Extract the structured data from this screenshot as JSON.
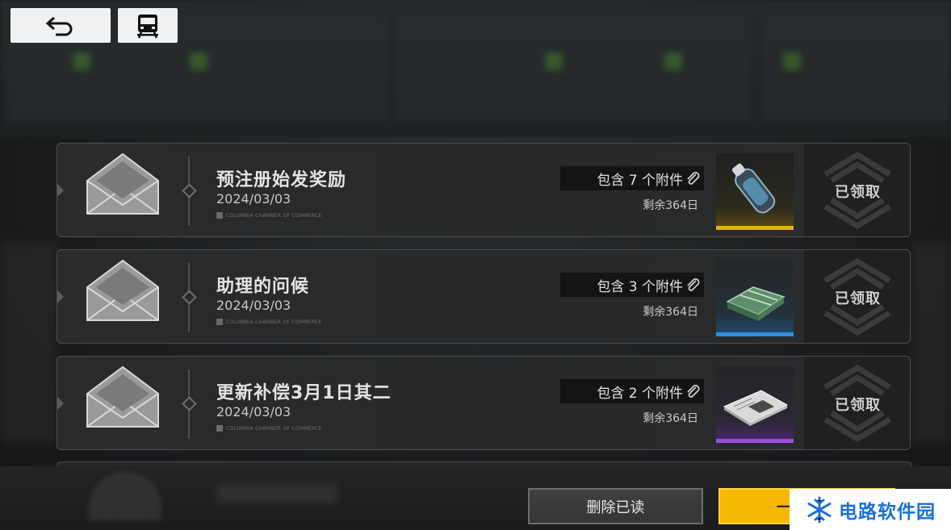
{
  "top_buttons": {
    "back_icon": "undo-arrow-icon",
    "train_icon": "train-icon"
  },
  "mails": [
    {
      "title": "预注册始发奖励",
      "date": "2024/03/03",
      "sender": "COLUMBIA CHAMBER OF COMMERCE",
      "attachments_label": "包含 7 个附件",
      "remaining": "剩余364日",
      "status": "已领取",
      "rarity_color": "#e0b21a"
    },
    {
      "title": "助理的问候",
      "date": "2024/03/03",
      "sender": "COLUMBIA CHAMBER OF COMMERCE",
      "attachments_label": "包含 3 个附件",
      "remaining": "剩余364日",
      "status": "已领取",
      "rarity_color": "#2f8fe0"
    },
    {
      "title": "更新补偿3月1日其二",
      "date": "2024/03/03",
      "sender": "COLUMBIA CHAMBER OF COMMERCE",
      "attachments_label": "包含 2 个附件",
      "remaining": "剩余364日",
      "status": "已领取",
      "rarity_color": "#9a4ee0"
    }
  ],
  "bottom": {
    "delete_read_label": "删除已读",
    "claim_all_label": "一"
  },
  "watermark": {
    "text": "电路软件园"
  },
  "colors": {
    "accent_yellow": "#f6b800",
    "watermark_blue": "#1d6fd6"
  }
}
